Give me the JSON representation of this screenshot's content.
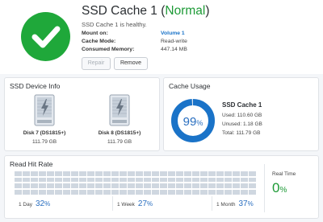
{
  "header": {
    "title_prefix": "SSD Cache 1 (",
    "title_status": "Normal",
    "title_suffix": ")",
    "subtitle": "SSD Cache 1 is healthy.",
    "status_color": "#1fa83a",
    "status_icon": "checkmark-icon",
    "info": [
      {
        "label": "Mount on:",
        "value": "Volume 1"
      },
      {
        "label": "Cache Mode:",
        "value": "Read-write"
      },
      {
        "label": "Consumed Memory:",
        "value": "447.14 MB"
      }
    ],
    "buttons": {
      "repair": "Repair",
      "remove": "Remove"
    }
  },
  "device_info": {
    "title": "SSD Device Info",
    "disks": [
      {
        "name": "Disk 7 (DS1815+)",
        "size": "111.79 GB"
      },
      {
        "name": "Disk 8 (DS1815+)",
        "size": "111.79 GB"
      }
    ]
  },
  "cache_usage": {
    "title": "Cache Usage",
    "percent_value": "99",
    "percent_fraction": 0.99,
    "percent_sign": "%",
    "accent_color": "#1a73c8",
    "name": "SSD Cache 1",
    "used": "Used: 110.60 GB",
    "unused": "Unused: 1.18 GB",
    "total": "Total: 111.79 GB"
  },
  "read_hit_rate": {
    "title": "Read Hit Rate",
    "items": [
      {
        "label": "1 Day",
        "value": "32",
        "sign": "%"
      },
      {
        "label": "1 Week",
        "value": "27",
        "sign": "%"
      },
      {
        "label": "1 Month",
        "value": "37",
        "sign": "%"
      }
    ],
    "real_time_label": "Real Time",
    "real_time_value": "0",
    "real_time_sign": "%"
  }
}
